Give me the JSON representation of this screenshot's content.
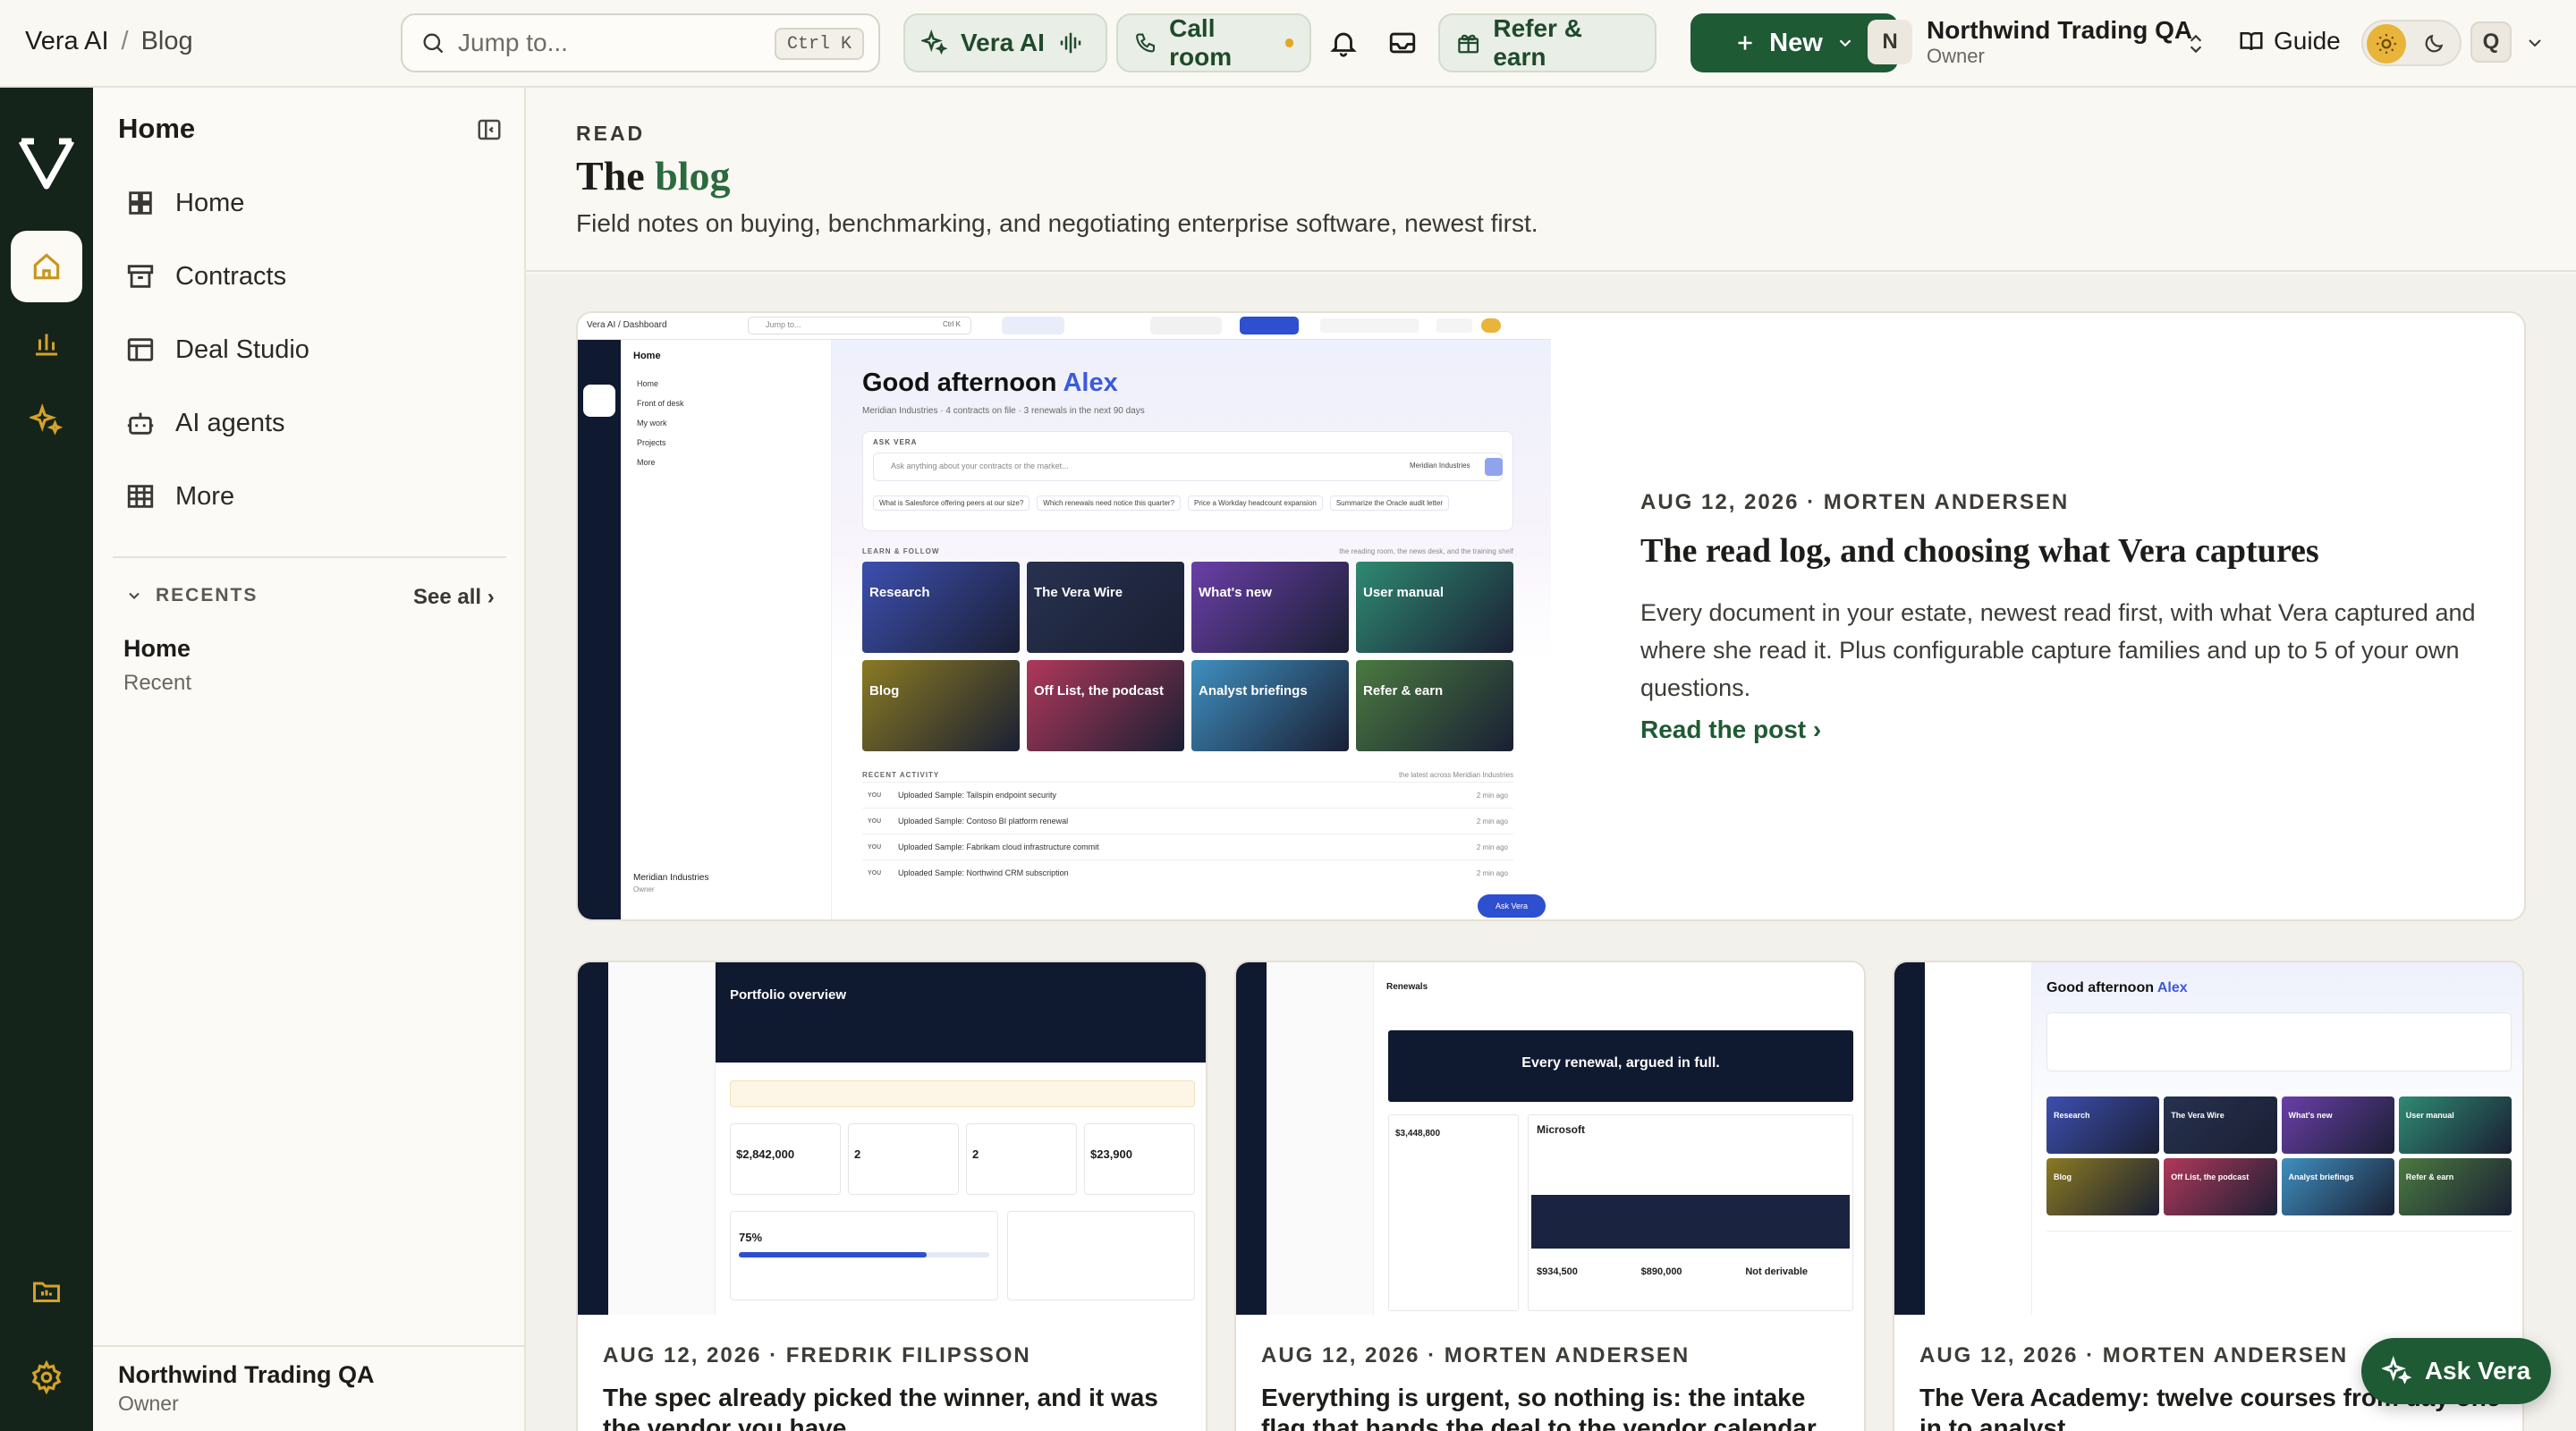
{
  "breadcrumb": {
    "app": "Vera AI",
    "separator": "/",
    "page": "Blog"
  },
  "search": {
    "placeholder": "Jump to...",
    "shortcut": "Ctrl K"
  },
  "topbar": {
    "vera_ai_label": "Vera AI",
    "call_room_label": "Call room",
    "refer_label": "Refer & earn",
    "new_label": "New",
    "workspace_initial": "N",
    "workspace_name": "Northwind Trading QA",
    "workspace_role": "Owner",
    "guide_label": "Guide",
    "user_initial": "Q"
  },
  "sidebar": {
    "title": "Home",
    "items": [
      {
        "label": "Home",
        "icon": "grid-icon"
      },
      {
        "label": "Contracts",
        "icon": "archive-icon"
      },
      {
        "label": "Deal Studio",
        "icon": "layout-icon"
      },
      {
        "label": "AI agents",
        "icon": "robot-icon"
      },
      {
        "label": "More",
        "icon": "table-icon"
      }
    ],
    "recents_label": "RECENTS",
    "see_all": "See all ›",
    "recent_item": {
      "name": "Home",
      "sub": "Recent"
    },
    "footer": {
      "name": "Northwind Trading QA",
      "role": "Owner"
    }
  },
  "hero": {
    "eyebrow": "READ",
    "title_prefix": "The",
    "title_accent": "blog",
    "lede": "Field notes on buying, benchmarking, and negotiating enterprise software, newest first."
  },
  "featured": {
    "meta": "AUG 12, 2026 · MORTEN ANDERSEN",
    "title": "The read log, and choosing what Vera captures",
    "description": "Every document in your estate, newest read first, with what Vera captured and where she read it. Plus configurable capture families and up to 5 of your own questions.",
    "link": "Read the post ›",
    "screenshot": {
      "crumb": "Vera AI  /  Dashboard",
      "search": "Jump to...",
      "kbd": "Ctrl K",
      "greeting": "Good afternoon",
      "greeting_name": "Alex",
      "sub": "Meridian Industries · 4 contracts on file · 3 renewals in the next 90 days",
      "ask_label": "ASK VERA",
      "ask_placeholder": "Ask anything about your contracts or the market...",
      "ask_chip": "Meridian Industries",
      "suggestions": [
        "What is Salesforce offering peers at our size?",
        "Which renewals need notice this quarter?",
        "Price a Workday headcount expansion",
        "Summarize the Oracle audit letter"
      ],
      "learn_label": "LEARN & FOLLOW",
      "learn_right": "the reading room, the news desk, and the training shelf",
      "tiles": [
        {
          "label": "Research",
          "color": "#3d4fb0"
        },
        {
          "label": "The Vera Wire",
          "color": "#27324f"
        },
        {
          "label": "What's new",
          "color": "#6a3fa8"
        },
        {
          "label": "User manual",
          "color": "#2f8a72"
        },
        {
          "label": "Blog",
          "color": "#8a7a22"
        },
        {
          "label": "Off List, the podcast",
          "color": "#b0385a"
        },
        {
          "label": "Analyst briefings",
          "color": "#3f8fc0"
        },
        {
          "label": "Refer & earn",
          "color": "#4a7a40"
        }
      ],
      "activity_label": "RECENT ACTIVITY",
      "activity_right": "the latest across Meridian Industries",
      "activity": [
        {
          "who": "YOU",
          "text": "Uploaded Sample: Tailspin endpoint security",
          "time": "2 min ago"
        },
        {
          "who": "YOU",
          "text": "Uploaded Sample: Contoso BI platform renewal",
          "time": "2 min ago"
        },
        {
          "who": "YOU",
          "text": "Uploaded Sample: Fabrikam cloud infrastructure commit",
          "time": "2 min ago"
        },
        {
          "who": "YOU",
          "text": "Uploaded Sample: Northwind CRM subscription",
          "time": "2 min ago"
        }
      ],
      "side_items": [
        "Home",
        "Front of desk",
        "My work",
        "Projects",
        "More"
      ],
      "org": "Meridian Industries",
      "org_role": "Owner",
      "ask_btn": "Ask Vera"
    }
  },
  "cards": [
    {
      "meta": "AUG 12, 2026 · FREDRIK FILIPSSON",
      "title": "The spec already picked the winner, and it was the vendor you have",
      "screenshot": {
        "heading": "Portfolio overview",
        "stat1": "$2,842,000",
        "stat2": "2",
        "stat3": "2",
        "stat4": "$23,900",
        "pct": "75%"
      }
    },
    {
      "meta": "AUG 12, 2026 · MORTEN ANDERSEN",
      "title": "Everything is urgent, so nothing is: the intake flag that hands the deal to the vendor calendar",
      "screenshot": {
        "heading": "Renewals",
        "banner": "Every renewal, argued in full.",
        "vendor": "Microsoft",
        "amount": "$3,448,800",
        "v1": "$934,500",
        "v2": "$890,000",
        "v3": "Not derivable"
      }
    },
    {
      "meta": "AUG 12, 2026 · MORTEN ANDERSEN",
      "title": "The Vera Academy: twelve courses from day one in to analyst",
      "screenshot": {
        "greeting": "Good afternoon",
        "greeting_name": "Alex"
      }
    }
  ],
  "ask_vera": "Ask Vera",
  "colors": {
    "brand": "#1e5a34",
    "rail": "#15241a",
    "accent": "#2a6a3e"
  }
}
